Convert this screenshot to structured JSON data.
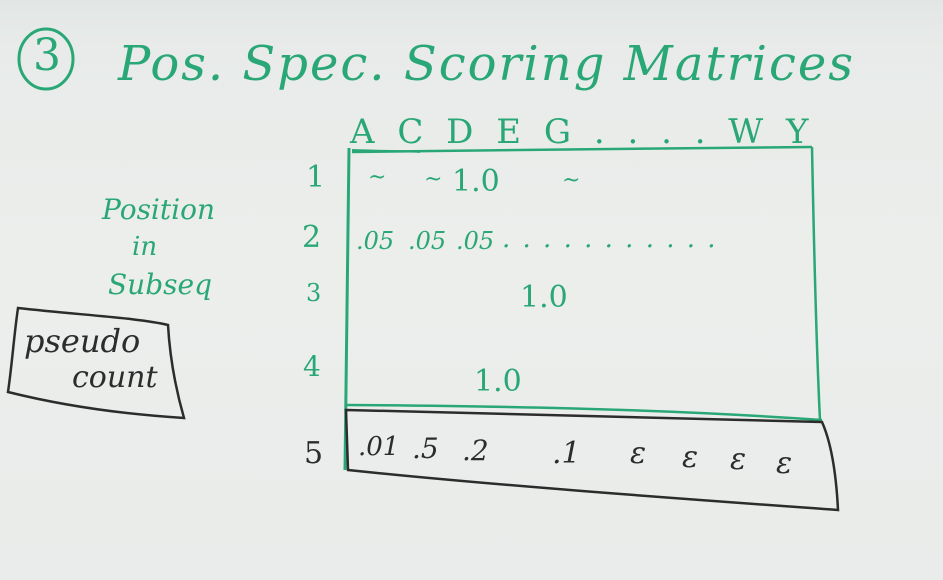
{
  "heading": {
    "number": "3",
    "title": "Pos. Spec. Scoring Matrices"
  },
  "columns": {
    "header": "A C D E G . . . .   W Y"
  },
  "row_label": {
    "line1": "Position",
    "line2": "in",
    "line3": "Subseq"
  },
  "boxed_note": {
    "line1": "pseudo",
    "line2": "count"
  },
  "rows": [
    {
      "index": "1",
      "cells": [
        "~",
        "~",
        "1.0",
        "~"
      ]
    },
    {
      "index": "2",
      "cells": [
        ".05",
        ".05",
        ".05",
        ". . . . . . . . . . ."
      ]
    },
    {
      "index": "3",
      "cells": [
        "1.0"
      ]
    },
    {
      "index": "4",
      "cells": [
        "1.0"
      ]
    },
    {
      "index": "5",
      "cells": [
        ".01",
        ".5",
        ".2",
        ".1",
        "ε",
        "ε",
        "ε",
        "ε"
      ]
    }
  ]
}
